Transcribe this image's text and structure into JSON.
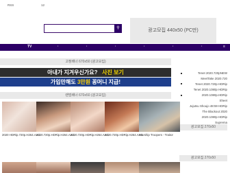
{
  "topbar": {
    "rss": "RSS",
    "item1": "",
    "item2": "12",
    "item3": ""
  },
  "search": {
    "placeholder": ""
  },
  "ads": {
    "top_right": "광고모집 440x50 (PC만)",
    "banner1": "고정배너 670x50 (광고모집)",
    "banner2_left": "아내가 지겨우신가요?",
    "banner2_right": "사진 보기",
    "banner3_left": "가입만해도",
    "banner3_mid": "3만원",
    "banner3_right": "꽁머니 지급!",
    "banner4": "랜덤배너 670x50 (광고모집)",
    "right1": "광고모집 270x50",
    "right2": "광고모집 270x50"
  },
  "nav": {
    "tv": "TV"
  },
  "sidebar": {
    "items": [
      "Tenet 2020.720pNEW",
      "MeetTake 2020.720",
      "Tenet 2020.720p HDRip",
      "Tenet 2020.1080p HDRip",
      "2020.1080p.HDRip",
      "Sheet",
      "Jujutsu Shoujo 48:59 HDRip",
      "The Blackout 2020",
      "2020.1080p HDRip",
      "Suprema"
    ]
  },
  "posts": [
    {
      "caption": "2020 HDRip.720p.H264.AAC"
    },
    {
      "caption": "2020.720p.HDRip.H264.AAC"
    },
    {
      "caption": "2020.720p.HDRip.H264.AAC"
    },
    {
      "caption": "2020.720p.HDRip.H264.AAC"
    },
    {
      "caption": "Starship Troopers - Traitor"
    }
  ]
}
